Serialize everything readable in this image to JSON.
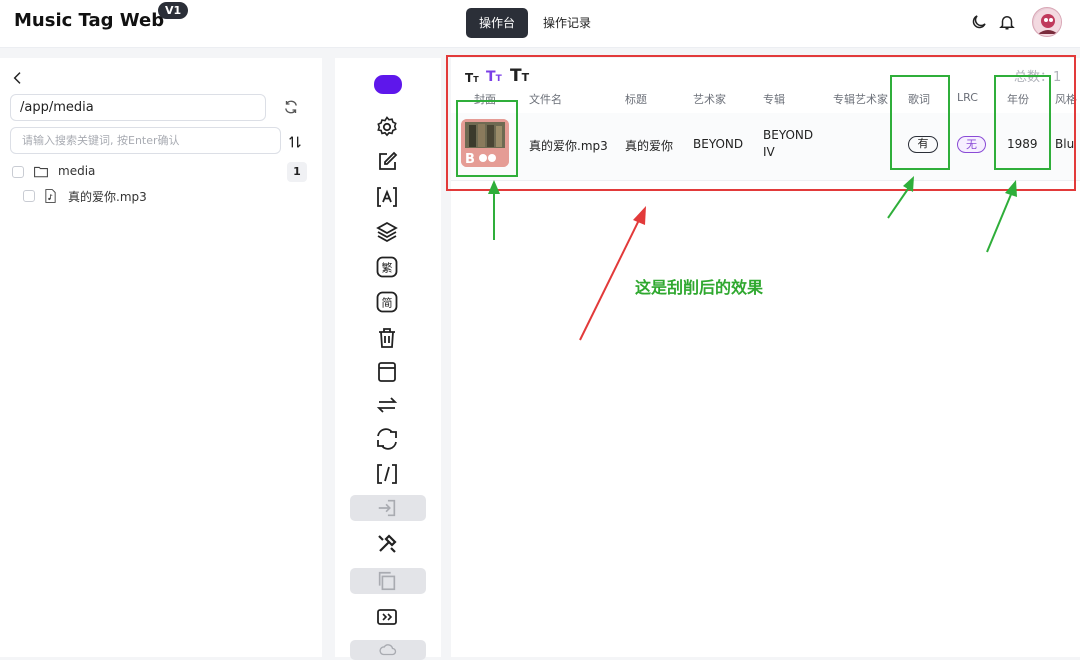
{
  "app": {
    "title": "Music Tag Web",
    "version": "V1"
  },
  "tabs": [
    {
      "label": "操作台",
      "active": true
    },
    {
      "label": "操作记录",
      "active": false
    }
  ],
  "left": {
    "path_value": "/app/media",
    "search_placeholder": "请输入搜索关键词, 按Enter确认",
    "tree": [
      {
        "label": "media",
        "type": "folder",
        "count": "1"
      },
      {
        "label": "真的爱你.mp3",
        "type": "file"
      }
    ]
  },
  "toolbar": {
    "accent": "#5e17eb",
    "icons": [
      "gear-icon",
      "edit-icon",
      "text-recognize-icon",
      "layers-icon",
      "traditional-chinese-icon",
      "simplified-chinese-icon",
      "trash-icon",
      "archive-icon",
      "swap-icon",
      "convert-icon",
      "rename-icon",
      "import-icon",
      "tools-icon",
      "copy-icon",
      "playlist-icon",
      "upload-icon"
    ]
  },
  "main": {
    "total": "总数：1",
    "columns": [
      "封面",
      "文件名",
      "标题",
      "艺术家",
      "专辑",
      "专辑艺术家",
      "歌词",
      "LRC",
      "年份",
      "风格"
    ],
    "rows": [
      {
        "filename": "真的爱你.mp3",
        "title": "真的爱你",
        "artist": "BEYOND",
        "album_line1": "BEYOND",
        "album_line2": "IV",
        "album_artist": "",
        "lyrics": "有",
        "lrc": "无",
        "year": "1989",
        "genre": "Blu"
      }
    ]
  },
  "annotation": {
    "text": "这是刮削后的效果",
    "red": "#e23a3a",
    "green": "#2fae3a"
  }
}
